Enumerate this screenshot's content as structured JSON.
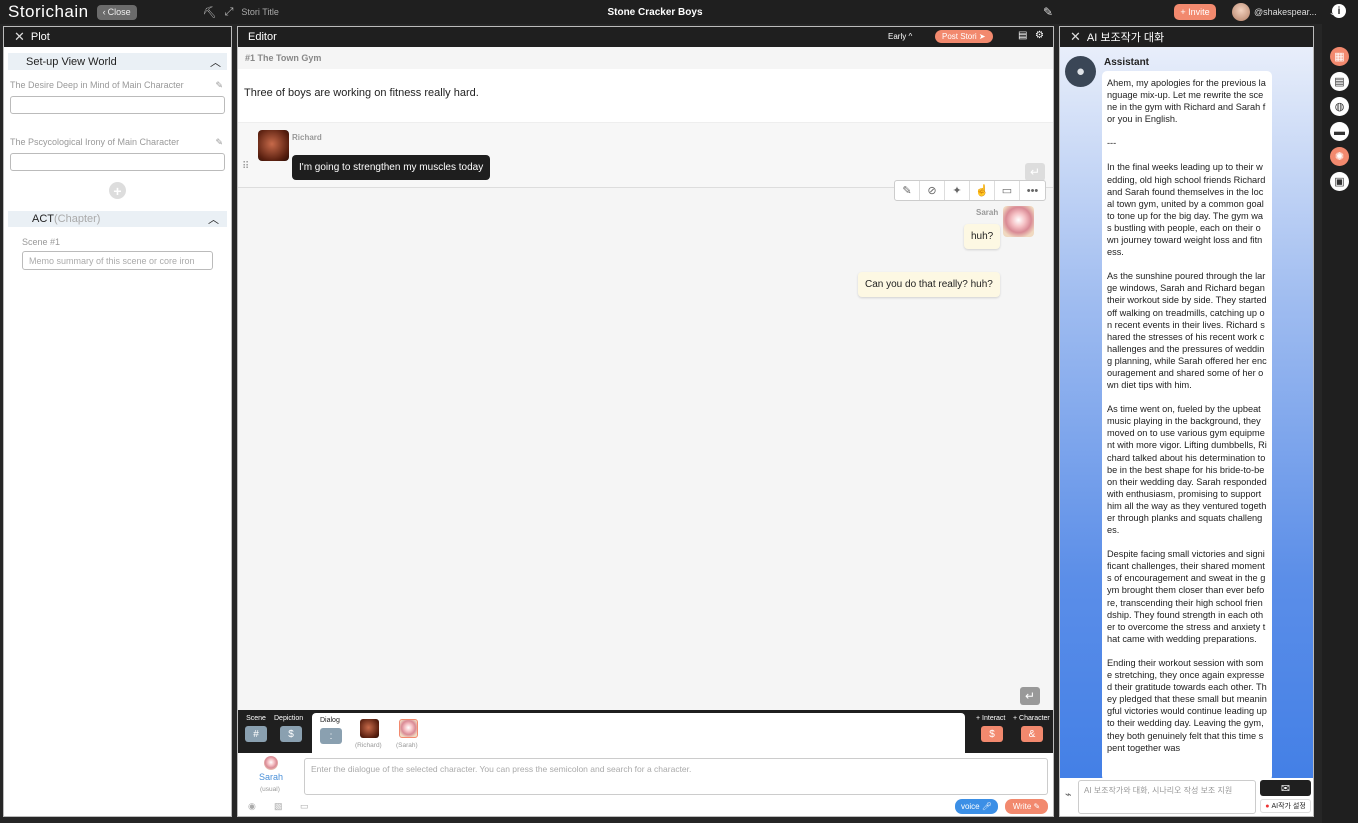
{
  "app": {
    "logo": "Storichain",
    "close_label": "Close",
    "stori_title_label": "Stori Title",
    "doc_title": "Stone Cracker Boys",
    "invite_label": "+ Invite",
    "username": "@shakespear...",
    "info_glyph": "i"
  },
  "plot": {
    "title": "Plot",
    "setup_section": "Set-up View World",
    "fields": [
      {
        "label": "The Desire Deep in Mind of Main Character",
        "value": ""
      },
      {
        "label": "The Pscycological Irony of Main Character",
        "value": ""
      }
    ],
    "act_label": "ACT",
    "act_sub": "(Chapter)",
    "scene_label": "Scene #1",
    "memo_placeholder": "Memo summary of this scene or core iron"
  },
  "editor": {
    "title": "Editor",
    "early_label": "Early ^",
    "post_label": "Post Stori",
    "scene_title": "#1 The Town Gym",
    "depiction": "Three of boys are working on fitness really hard.",
    "dialogs": [
      {
        "speaker": "Richard",
        "text": "I'm going to strengthen my muscles today"
      },
      {
        "speaker": "Sarah",
        "text": "huh?"
      },
      {
        "speaker": "Sarah",
        "text": "Can you do that really? huh?"
      }
    ],
    "composer": {
      "tab_scene": "Scene",
      "tab_scene_glyph": "#",
      "tab_depiction": "Depiction",
      "tab_depiction_glyph": "$",
      "tab_dialog": "Dialog",
      "tab_dialog_glyph": ":",
      "char1": "(Richard)",
      "char2": "(Sarah)",
      "interact_label": "+ Interact",
      "interact_glyph": "$",
      "character_label": "+ Character",
      "character_glyph": "&",
      "current_char": "Sarah",
      "current_mood": "(usual)",
      "placeholder": "Enter the dialogue of the selected character. You can press the semicolon and search for a character.",
      "voice_label": "voice",
      "write_label": "Write"
    }
  },
  "ai": {
    "title": "AI 보조작가 대화",
    "assistant_name": "Assistant",
    "message_paragraphs": [
      "Ahem, my apologies for the previous language mix-up. Let me rewrite the scene in the gym with Richard and Sarah for you in English.",
      "---",
      "In the final weeks leading up to their wedding, old high school friends Richard and Sarah found themselves in the local town gym, united by a common goal to tone up for the big day. The gym was bustling with people, each on their own journey toward weight loss and fitness.",
      "As the sunshine poured through the large windows, Sarah and Richard began their workout side by side. They started off walking on treadmills, catching up on recent events in their lives. Richard shared the stresses of his recent work challenges and the pressures of wedding planning, while Sarah offered her encouragement and shared some of her own diet tips with him.",
      "As time went on, fueled by the upbeat music playing in the background, they moved on to use various gym equipment with more vigor. Lifting dumbbells, Richard talked about his determination to be in the best shape for his bride-to-be on their wedding day. Sarah responded with enthusiasm, promising to support him all the way as they ventured together through planks and squats challenges.",
      "Despite facing small victories and significant challenges, their shared moments of encouragement and sweat in the gym brought them closer than ever before, transcending their high school friendship. They found strength in each other to overcome the stress and anxiety that came with wedding preparations.",
      "Ending their workout session with some stretching, they once again expressed their gratitude towards each other. They pledged that these small but meaningful victories would continue leading up to their wedding day. Leaving the gym, they both genuinely felt that this time spent together was"
    ],
    "input_placeholder": "AI 보조작가와 대화, 시나리오 작성 보조 지원",
    "settings_label": "AI작가 설정"
  },
  "colors": {
    "accent": "#f2896e",
    "dark": "#1f1f1f",
    "bubble": "#fdf8e3"
  }
}
